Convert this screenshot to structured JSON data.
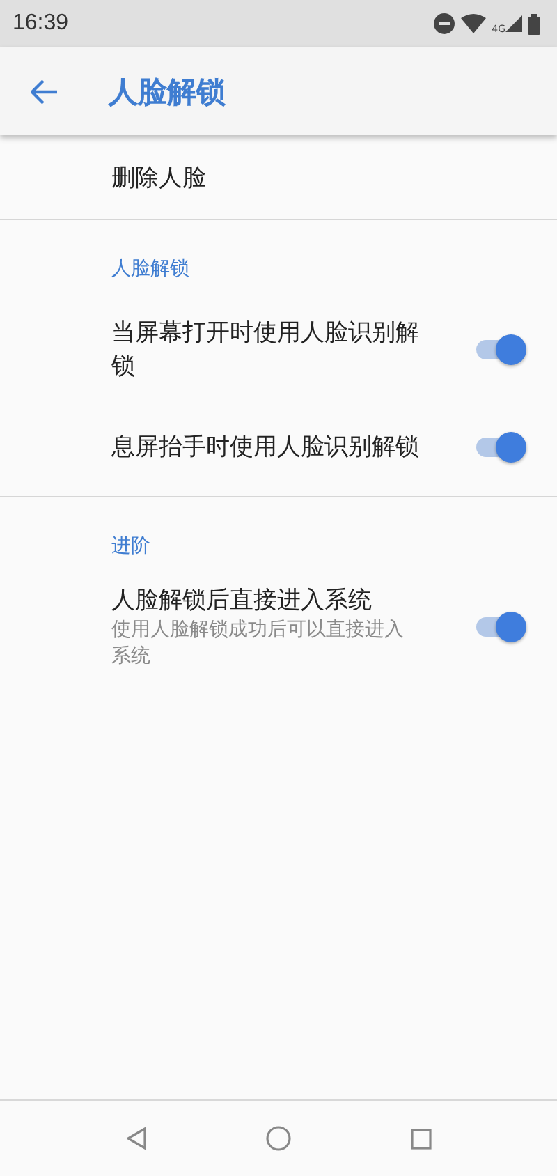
{
  "status_bar": {
    "time": "16:39",
    "network": "4G"
  },
  "app_bar": {
    "title": "人脸解锁"
  },
  "sections": [
    {
      "items": [
        {
          "kind": "action",
          "title": "删除人脸"
        }
      ]
    },
    {
      "header": "人脸解锁",
      "items": [
        {
          "kind": "switch",
          "title": "当屏幕打开时使用人脸识别解锁",
          "on": true
        },
        {
          "kind": "switch",
          "title": "息屏抬手时使用人脸识别解锁",
          "on": true
        }
      ]
    },
    {
      "header": "进阶",
      "items": [
        {
          "kind": "switch",
          "title": "人脸解锁后直接进入系统",
          "summary": "使用人脸解锁成功后可以直接进入系统",
          "on": true
        }
      ]
    }
  ]
}
